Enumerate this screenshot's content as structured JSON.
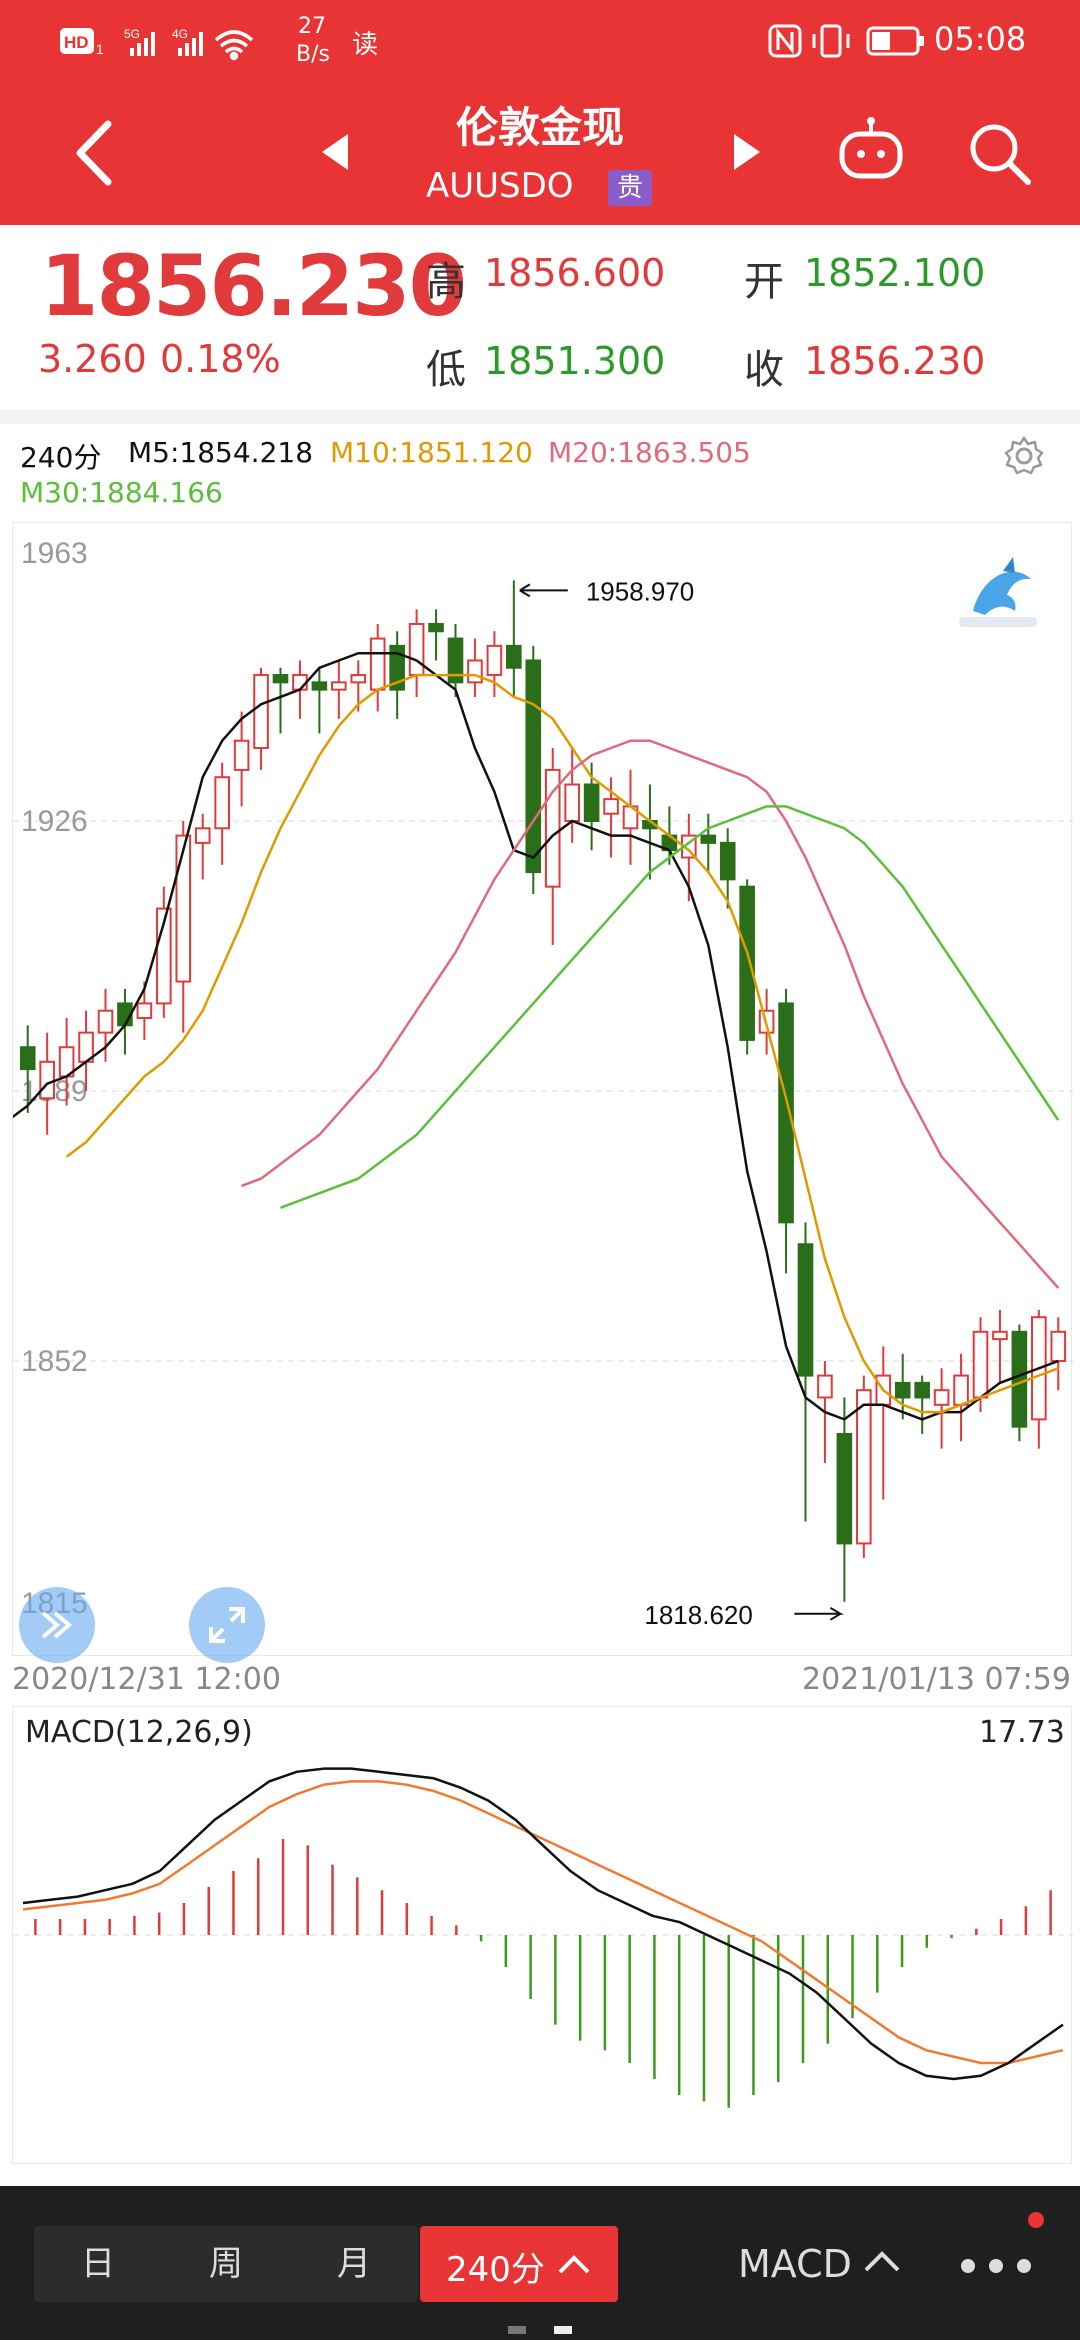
{
  "status_bar": {
    "left_icons": [
      "hd-icon",
      "5g-signal-icon",
      "4g-signal-icon",
      "wifi-icon"
    ],
    "speed_value": "27",
    "speed_unit": "B/s",
    "read_label": "读",
    "right_icons": [
      "nfc-icon",
      "vibrate-icon",
      "battery-icon"
    ],
    "time": "05:08"
  },
  "header": {
    "title": "伦敦金现",
    "subtitle": "AUUSDO",
    "badge": "贵",
    "icons": [
      "back-icon",
      "prev-icon",
      "next-icon",
      "robot-icon",
      "search-icon"
    ]
  },
  "quote": {
    "price": "1856.230",
    "change": "3.260",
    "change_pct": "0.18%",
    "high_label": "高",
    "high": "1856.600",
    "open_label": "开",
    "open": "1852.100",
    "low_label": "低",
    "low": "1851.300",
    "close_label": "收",
    "close": "1856.230"
  },
  "ma_legend": {
    "period": "240分",
    "m5": "M5:1854.218",
    "m10": "M10:1851.120",
    "m20": "M20:1863.505",
    "m30": "M30:1884.166"
  },
  "chart_data": {
    "type": "candlestick",
    "y_axis_labels": [
      "1963",
      "1926",
      "1889",
      "1852",
      "1815"
    ],
    "ylim": [
      1815,
      1963
    ],
    "grid": true,
    "max_annotation": "1958.970",
    "min_annotation": "1818.620",
    "x_start": "2020/12/31 12:00",
    "x_end": "2021/01/13 07:59",
    "candles": [
      [
        1895,
        1892,
        1898,
        1886
      ],
      [
        1888,
        1893,
        1897,
        1883
      ],
      [
        1891,
        1895,
        1899,
        1887
      ],
      [
        1893,
        1897,
        1900,
        1889
      ],
      [
        1897,
        1900,
        1903,
        1893
      ],
      [
        1901,
        1898,
        1903,
        1894
      ],
      [
        1899,
        1901,
        1904,
        1896
      ],
      [
        1901,
        1914,
        1917,
        1899
      ],
      [
        1904,
        1924,
        1926,
        1897
      ],
      [
        1923,
        1925,
        1927,
        1918
      ],
      [
        1925,
        1932,
        1934,
        1920
      ],
      [
        1933,
        1937,
        1941,
        1928
      ],
      [
        1936,
        1946,
        1947,
        1933
      ],
      [
        1946,
        1945,
        1947,
        1938
      ],
      [
        1944,
        1946,
        1948,
        1940
      ],
      [
        1945,
        1944,
        1947,
        1938
      ],
      [
        1944,
        1945,
        1948,
        1940
      ],
      [
        1945,
        1946,
        1948,
        1941
      ],
      [
        1944,
        1951,
        1953,
        1941
      ],
      [
        1950,
        1944,
        1952,
        1940
      ],
      [
        1946,
        1953,
        1955,
        1943
      ],
      [
        1953,
        1952,
        1955,
        1948
      ],
      [
        1951,
        1945,
        1953,
        1943
      ],
      [
        1945,
        1948,
        1951,
        1943
      ],
      [
        1946,
        1950,
        1952,
        1943
      ],
      [
        1950,
        1947,
        1958.97,
        1943
      ],
      [
        1948,
        1919,
        1950,
        1916
      ],
      [
        1917,
        1933,
        1936,
        1909
      ],
      [
        1926,
        1931,
        1936,
        1923
      ],
      [
        1931,
        1926,
        1934,
        1922
      ],
      [
        1927,
        1929,
        1932,
        1921
      ],
      [
        1925,
        1928,
        1933,
        1920
      ],
      [
        1926,
        1925,
        1931,
        1918
      ],
      [
        1924,
        1922,
        1928,
        1920
      ],
      [
        1921,
        1924,
        1927,
        1915
      ],
      [
        1924,
        1923,
        1927,
        1919
      ],
      [
        1923,
        1918,
        1925,
        1914
      ],
      [
        1917,
        1896,
        1918,
        1894
      ],
      [
        1897,
        1900,
        1903,
        1894
      ],
      [
        1901,
        1871,
        1903,
        1864
      ],
      [
        1868,
        1850,
        1871,
        1830
      ],
      [
        1847,
        1850,
        1852,
        1838
      ],
      [
        1842,
        1827,
        1847,
        1819
      ],
      [
        1827,
        1848,
        1850,
        1825
      ],
      [
        1846,
        1850,
        1854,
        1833
      ],
      [
        1849,
        1847,
        1853,
        1844
      ],
      [
        1849,
        1847,
        1850,
        1842
      ],
      [
        1846,
        1848,
        1851,
        1840
      ],
      [
        1846,
        1850,
        1853,
        1841
      ],
      [
        1847,
        1856,
        1858,
        1845
      ],
      [
        1855,
        1856,
        1859,
        1849
      ],
      [
        1856,
        1843,
        1857,
        1841
      ],
      [
        1844,
        1858,
        1859,
        1840
      ],
      [
        1852,
        1856,
        1858,
        1848
      ]
    ],
    "series": [
      {
        "name": "M5",
        "color": "#111111",
        "values": [
          1885,
          1887,
          1890,
          1891,
          1893,
          1895,
          1898,
          1903,
          1912,
          1922,
          1932,
          1937,
          1940,
          1942,
          1943,
          1944,
          1947,
          1948,
          1949,
          1949,
          1949,
          1948,
          1946,
          1944,
          1936,
          1930,
          1922,
          1921,
          1924,
          1926,
          1925,
          1924,
          1924,
          1923,
          1922,
          1917,
          1909,
          1895,
          1878,
          1867,
          1854,
          1847,
          1845,
          1844,
          1846,
          1846,
          1845,
          1844,
          1845,
          1845,
          1847,
          1849,
          1850,
          1851,
          1852
        ]
      },
      {
        "name": "M10",
        "color": "#e09a00",
        "values": [
          1880,
          1882,
          1885,
          1888,
          1891,
          1893,
          1896,
          1900,
          1906,
          1912,
          1919,
          1925,
          1930,
          1935,
          1939,
          1942,
          1944,
          1945,
          1946,
          1946,
          1946,
          1946,
          1945,
          1943,
          1942,
          1940,
          1936,
          1932,
          1930,
          1928,
          1926,
          1924,
          1922,
          1919,
          1915,
          1908,
          1898,
          1888,
          1877,
          1866,
          1858,
          1852,
          1848,
          1846,
          1845,
          1845,
          1846,
          1847,
          1848,
          1849,
          1850,
          1851
        ]
      },
      {
        "name": "M20",
        "color": "#e06a7a",
        "values": [
          1876,
          1877,
          1879,
          1881,
          1883,
          1886,
          1889,
          1892,
          1896,
          1900,
          1904,
          1908,
          1913,
          1918,
          1922,
          1926,
          1930,
          1933,
          1935,
          1936,
          1937,
          1937,
          1936,
          1935,
          1934,
          1933,
          1932,
          1930,
          1926,
          1921,
          1915,
          1909,
          1902,
          1896,
          1890,
          1885,
          1880,
          1877,
          1874,
          1871,
          1868,
          1865,
          1862
        ]
      },
      {
        "name": "M30",
        "color": "#5bbf3a",
        "values": [
          1873,
          1874,
          1875,
          1876,
          1877,
          1879,
          1881,
          1883,
          1886,
          1889,
          1892,
          1895,
          1898,
          1901,
          1904,
          1907,
          1910,
          1913,
          1916,
          1919,
          1921,
          1923,
          1925,
          1926,
          1927,
          1928,
          1928,
          1927,
          1926,
          1925,
          1923,
          1920,
          1917,
          1913,
          1909,
          1905,
          1901,
          1897,
          1893,
          1889,
          1885
        ]
      }
    ]
  },
  "macd": {
    "label": "MACD(12,26,9)",
    "value": "17.73",
    "dif": [
      10,
      11,
      12,
      14,
      16,
      20,
      28,
      36,
      42,
      48,
      51,
      52,
      52,
      51,
      50,
      49,
      46,
      42,
      36,
      28,
      20,
      14,
      10,
      6,
      4,
      0,
      -4,
      -8,
      -12,
      -18,
      -26,
      -34,
      -40,
      -44,
      -45,
      -44,
      -40,
      -34,
      -28
    ],
    "dea": [
      8,
      9,
      10,
      11,
      13,
      16,
      22,
      28,
      34,
      40,
      44,
      47,
      48,
      48,
      47,
      45,
      42,
      38,
      34,
      30,
      26,
      22,
      18,
      14,
      10,
      6,
      2,
      -2,
      -8,
      -14,
      -20,
      -26,
      -32,
      -36,
      -38,
      -40,
      -40,
      -38,
      -36
    ],
    "hist": [
      5,
      5,
      5,
      5,
      6,
      7,
      10,
      15,
      20,
      24,
      30,
      28,
      22,
      18,
      14,
      10,
      6,
      3,
      -2,
      -10,
      -20,
      -28,
      -33,
      -36,
      -40,
      -45,
      -50,
      -52,
      -54,
      -50,
      -46,
      -40,
      -34,
      -26,
      -18,
      -10,
      -4,
      -1,
      2,
      5,
      9,
      14
    ]
  },
  "bottom_bar": {
    "tabs": [
      "日",
      "周",
      "月",
      "240分"
    ],
    "active_tab": "240分",
    "indicator": "MACD",
    "more_icon": "more-icon"
  }
}
